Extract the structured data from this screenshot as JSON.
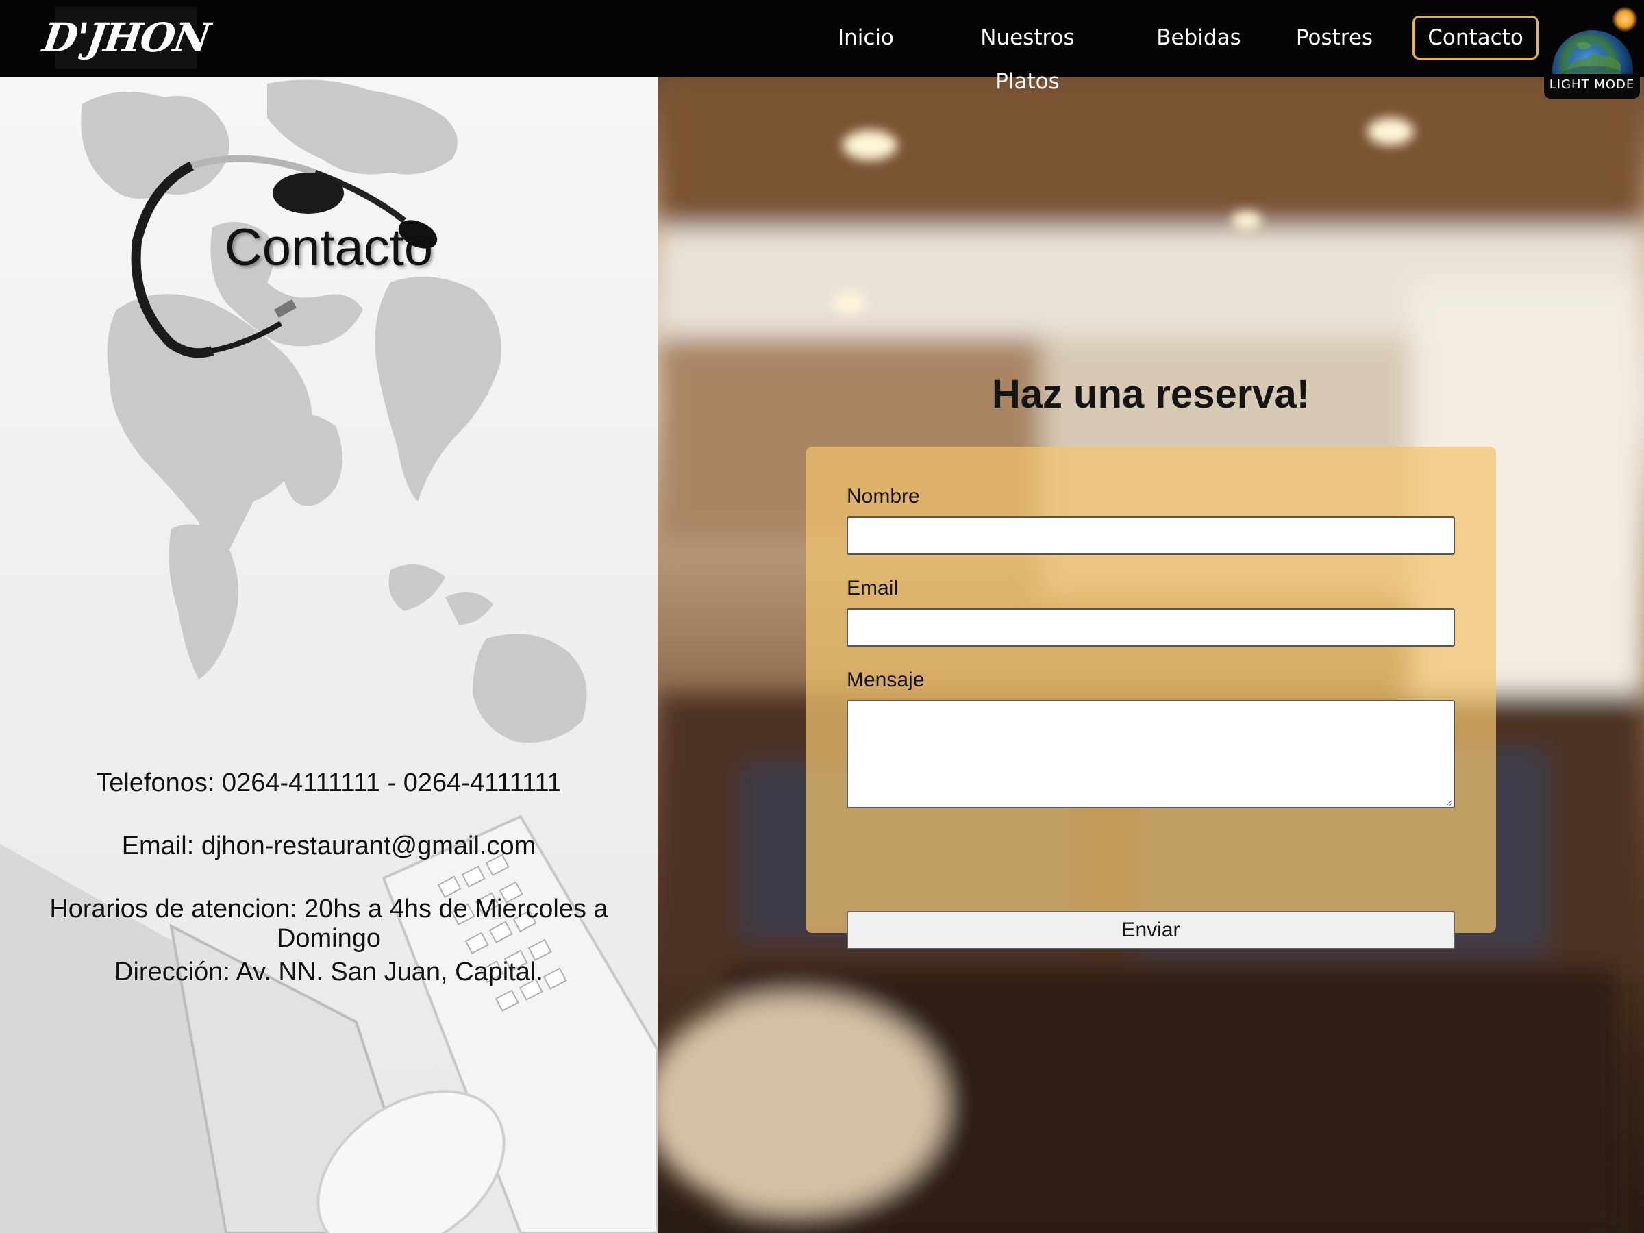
{
  "brand": {
    "logo_text": "D'JHON"
  },
  "nav": {
    "items": [
      {
        "label": "Inicio"
      },
      {
        "label": "Nuestros Platos"
      },
      {
        "label": "Bebidas"
      },
      {
        "label": "Postres"
      },
      {
        "label": "Contacto",
        "active": true
      }
    ],
    "theme_toggle_label": "LIGHT MODE"
  },
  "contact": {
    "title": "Contacto",
    "phones": "Telefonos: 0264-4111111 - 0264-4111111",
    "email": "Email: djhon-restaurant@gmail.com",
    "hours": "Horarios de atencion: 20hs a 4hs de Miercoles a Domingo",
    "address": "Dirección: Av. NN. San Juan, Capital."
  },
  "reservation": {
    "title": "Haz una reserva!",
    "fields": {
      "name_label": "Nombre",
      "name_value": "",
      "email_label": "Email",
      "email_value": "",
      "message_label": "Mensaje",
      "message_value": ""
    },
    "submit_label": "Enviar"
  },
  "colors": {
    "nav_background": "#050505",
    "active_nav_border": "#e8b24a",
    "form_card": "#f2c46e"
  }
}
